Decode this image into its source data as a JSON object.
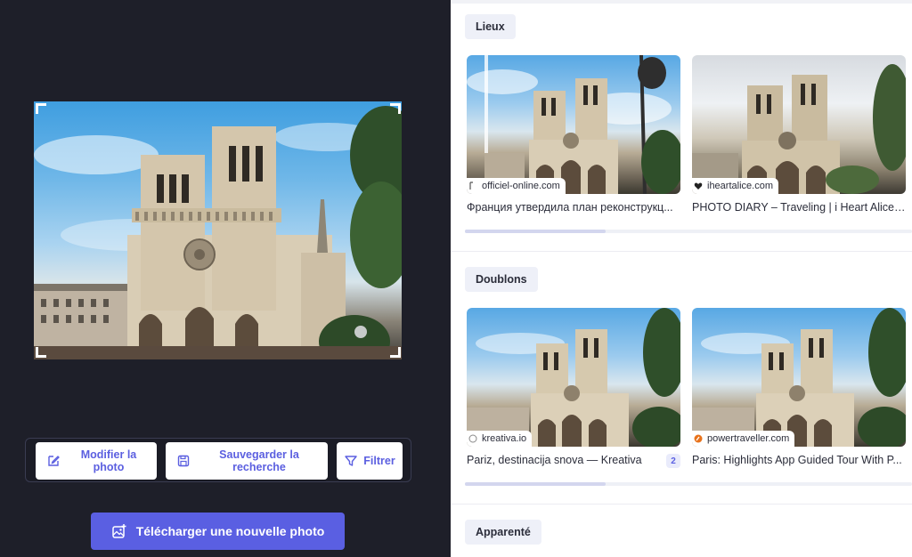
{
  "editor": {
    "buttons": {
      "modify": "Modifier la photo",
      "save_search": "Sauvegarder la recherche",
      "filter": "Filtrer"
    },
    "upload_label": "Télécharger une nouvelle photo",
    "icons": [
      "edit-icon",
      "save-icon",
      "filter-icon",
      "image-add-icon"
    ]
  },
  "results": {
    "sections": [
      {
        "label": "Lieux",
        "cards": [
          {
            "source": "officiel-online.com",
            "title": "Франция утвердила план реконструкц..."
          },
          {
            "source": "iheartalice.com",
            "title": "PHOTO DIARY – Traveling | i Heart Alice /..."
          }
        ]
      },
      {
        "label": "Doublons",
        "cards": [
          {
            "source": "kreativa.io",
            "title": "Pariz, destinacija snova — Kreativa",
            "badge": "2"
          },
          {
            "source": "powertraveller.com",
            "title": "Paris: Highlights App Guided Tour With P..."
          }
        ]
      },
      {
        "label": "Apparenté",
        "cards": []
      }
    ]
  },
  "colors": {
    "accent": "#5a5fe2",
    "panel_dark": "#1e1f29",
    "chip_bg": "#eef0f8"
  }
}
